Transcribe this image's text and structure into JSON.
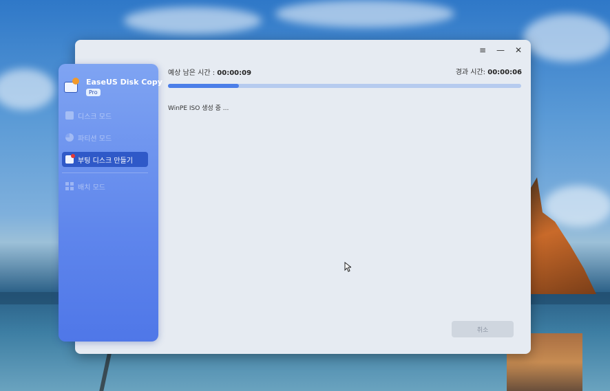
{
  "app": {
    "title": "EaseUS Disk Copy",
    "badge": "Pro"
  },
  "window_controls": {
    "menu": "≡",
    "minimize": "—",
    "close": "✕"
  },
  "sidebar": {
    "items": [
      {
        "label": "디스크 모드",
        "icon": "disk-icon",
        "active": false
      },
      {
        "label": "파티션 모드",
        "icon": "partition-icon",
        "active": false
      },
      {
        "label": "부팅 디스크 만들기",
        "icon": "bootable-disk-icon",
        "active": true
      },
      {
        "label": "배치 모드",
        "icon": "batch-icon",
        "active": false
      }
    ]
  },
  "progress": {
    "time_left_label": "예상 남은 시간 :",
    "time_left_value": "00:00:09",
    "elapsed_label": "경과 시간:",
    "elapsed_value": "00:00:06",
    "fraction": 0.2,
    "status": "WinPE ISO 생성 중 ..."
  },
  "buttons": {
    "cancel": "취소"
  },
  "colors": {
    "accent": "#4b7ee8",
    "sidebar_active": "#2f59c8",
    "sidebar_bg": "#5f86ec",
    "window_bg": "#e6ebf2"
  }
}
